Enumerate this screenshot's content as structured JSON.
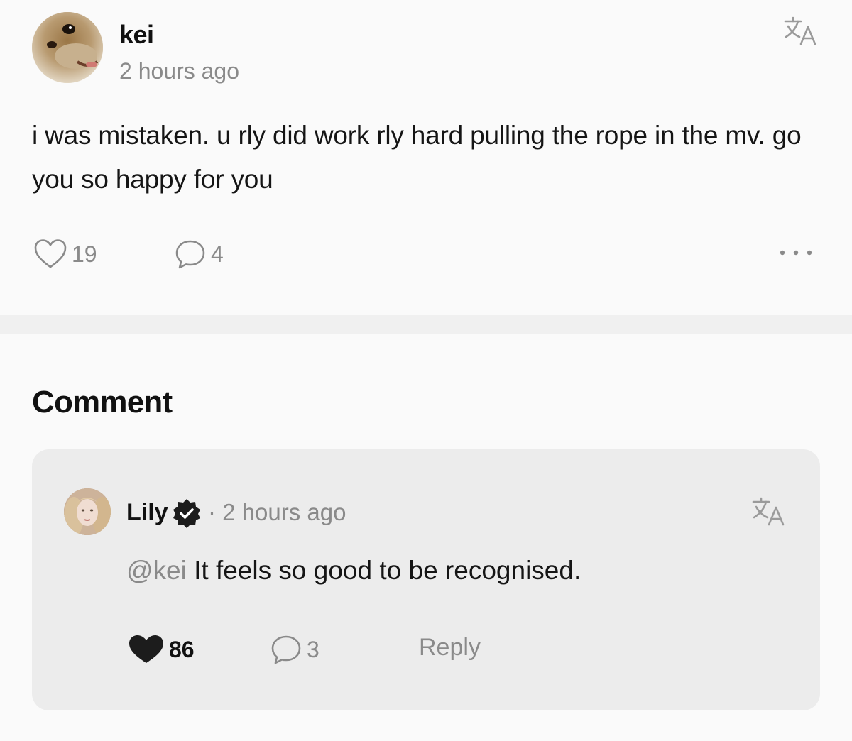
{
  "post": {
    "author": "kei",
    "time": "2 hours ago",
    "body": "i was mistaken. u rly did work rly hard pulling the rope in the mv. go you so happy for you",
    "likes": "19",
    "comments": "4",
    "avatar_icon": "dog-photo-avatar",
    "translate_icon": "translate-icon",
    "more_icon": "more-horizontal-icon"
  },
  "comment_section": {
    "heading": "Comment",
    "comment": {
      "author": "Lily",
      "verified": true,
      "separator": "·",
      "time": "2 hours ago",
      "mention": "@kei",
      "text": " It feels so good to be recognised.",
      "likes": "86",
      "liked": true,
      "replies": "3",
      "reply_label": "Reply",
      "avatar_icon": "person-photo-avatar",
      "translate_icon": "translate-icon"
    }
  },
  "colors": {
    "background": "#fafafa",
    "card": "#ececec",
    "muted_text": "#8a8a8a",
    "primary_text": "#111111"
  }
}
